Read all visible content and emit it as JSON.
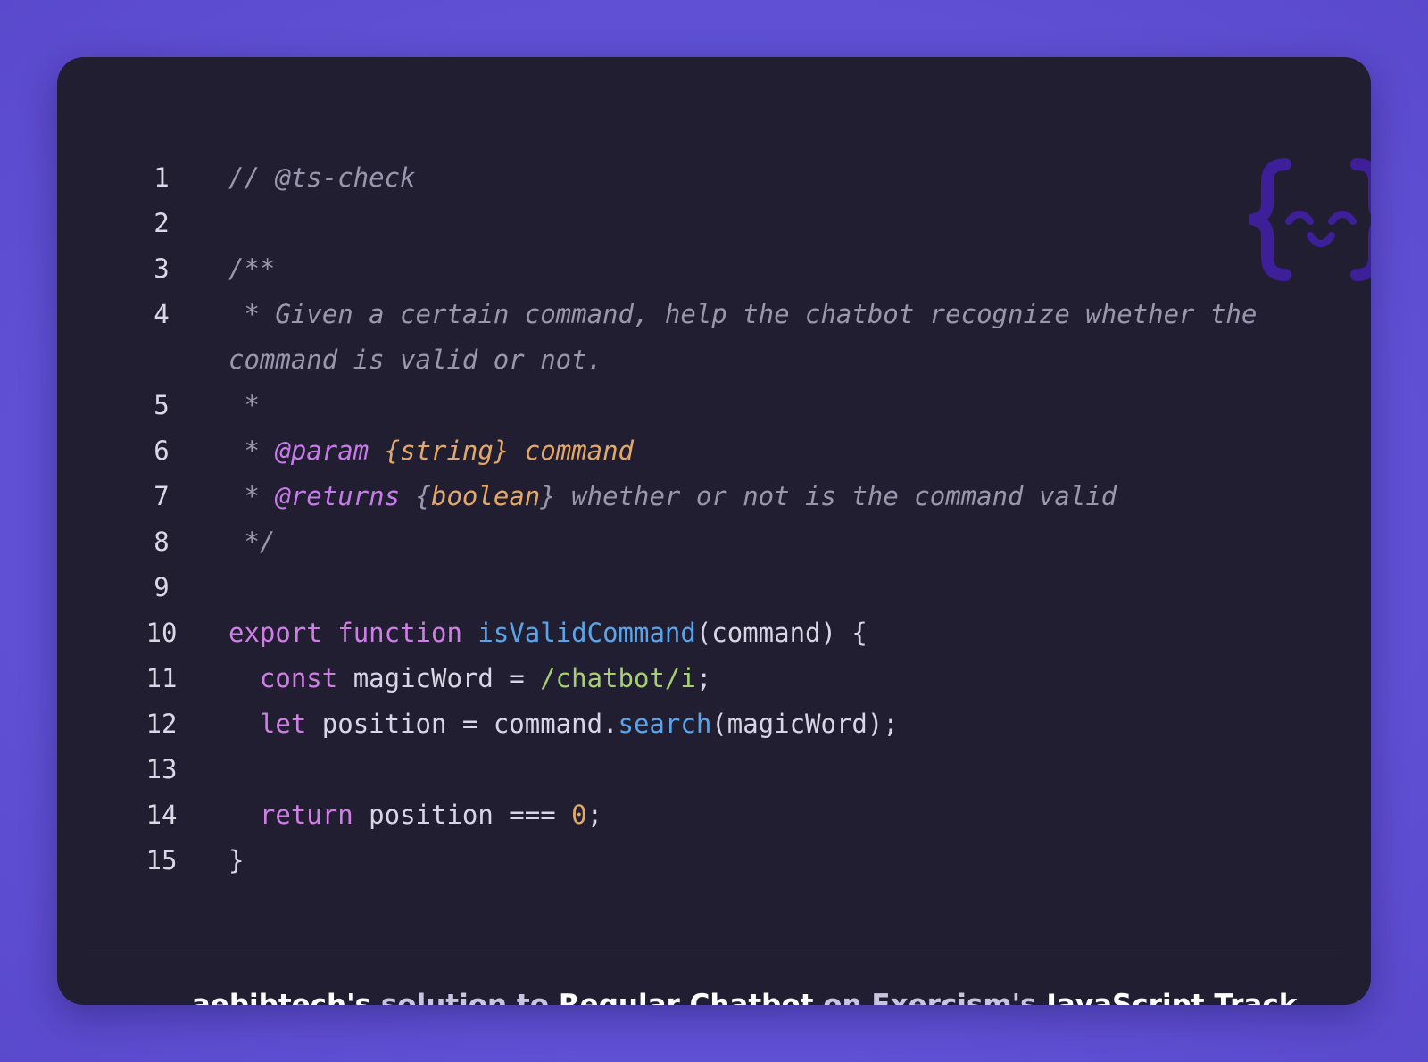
{
  "code": {
    "line_numbers": [
      "1",
      "2",
      "3",
      "4",
      "5",
      "6",
      "7",
      "8",
      "9",
      "10",
      "11",
      "12",
      "13",
      "14",
      "15"
    ],
    "line1": "// @ts-check",
    "line3": "/**",
    "line4_text": " * Given a certain command, help the chatbot recognize whether the command is valid or not.",
    "line5": " *",
    "line6_star": " * ",
    "line6_tag": "@param",
    "line6_type": "{string}",
    "line6_name": "command",
    "line7_star": " * ",
    "line7_tag": "@returns",
    "line7_type_open": "{",
    "line7_type": "boolean",
    "line7_type_close": "}",
    "line7_desc": " whether or not is the command valid",
    "line8": " */",
    "line10_kw1": "export",
    "line10_kw2": "function",
    "line10_fn": "isValidCommand",
    "line10_rest": "(command) {",
    "line11_kw": "const",
    "line11_mid": " magicWord = ",
    "line11_rx": "/chatbot/i",
    "line11_end": ";",
    "line12_kw": "let",
    "line12_mid": " position = command.",
    "line12_fn": "search",
    "line12_end": "(magicWord);",
    "line14_kw": "return",
    "line14_mid": " position === ",
    "line14_num": "0",
    "line14_end": ";",
    "line15": "}"
  },
  "footer": {
    "user": "aebibtech's",
    "solution_to": " solution to ",
    "exercise": "Regular Chatbot",
    "on": " on ",
    "exercism": "Exercism's",
    "track": " JavaScript Track."
  },
  "icons": {
    "logo": "exercism-logo-icon",
    "avatar": "user-avatar"
  },
  "colors": {
    "background": "#5b4bcf",
    "card": "#211e31",
    "comment": "#9a97ad",
    "keyword": "#cf7ee6",
    "function": "#5aa4ea",
    "regex": "#a6cf74",
    "number": "#e3a867"
  }
}
